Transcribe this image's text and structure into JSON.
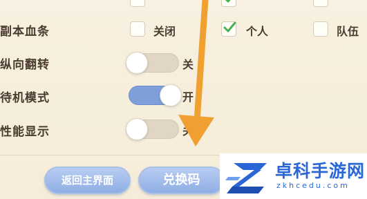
{
  "settings": {
    "dungeon_health_bar": {
      "label": "副本血条",
      "options": [
        {
          "label": "关闭",
          "checked": false
        },
        {
          "label": "个人",
          "checked": true
        },
        {
          "label": "队伍",
          "checked": false
        }
      ]
    },
    "vertical_flip": {
      "label": "纵向翻转",
      "state_text": "关",
      "on": false
    },
    "standby_mode": {
      "label": "待机模式",
      "state_text": "开",
      "on": true
    },
    "performance_display": {
      "label": "性能显示",
      "state_text": "关",
      "on": false
    }
  },
  "buttons": {
    "return_main": "返回主界面",
    "redeem_code": "兑换码"
  },
  "watermark": {
    "name": "卓科手游网",
    "url": "zkhcedu.com"
  },
  "colors": {
    "panel_bg": "#f7efdf",
    "toggle_on": "#7f9fdb",
    "toggle_off": "#e1d6c6",
    "check_green": "#4caf50",
    "arrow_orange": "#f0a030",
    "button_blue": "#8faee5",
    "watermark_blue": "#2a66d6"
  }
}
